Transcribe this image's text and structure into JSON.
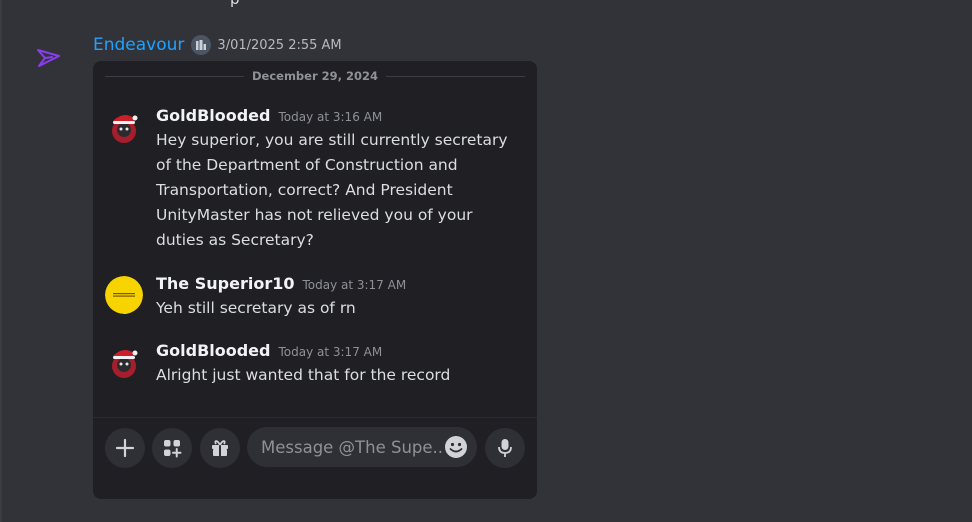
{
  "top_fragment": "p",
  "header": {
    "author": "Endeavour",
    "timestamp": "3/01/2025 2:55 AM"
  },
  "embed": {
    "date_divider": "December 29, 2024",
    "messages": [
      {
        "author": "GoldBlooded",
        "time": "Today at 3:16 AM",
        "text": "Hey superior, you are still currently secretary of the Department of Construction and Transportation, correct? And President UnityMaster has not relieved you of your duties as Secretary?",
        "avatar": "santa-hat-avatar"
      },
      {
        "author": "The Superior10",
        "time": "Today at 3:17 AM",
        "text": "Yeh still secretary as of rn",
        "avatar": "yellow-circle-avatar"
      },
      {
        "author": "GoldBlooded",
        "time": "Today at 3:17 AM",
        "text": "Alright just wanted that for the record",
        "avatar": "santa-hat-avatar"
      }
    ],
    "input": {
      "placeholder": "Message @The Supe..."
    }
  },
  "colors": {
    "background": "#323339",
    "card": "#1f1f24",
    "author_name": "#1ea2ff",
    "control": "#2f3036"
  }
}
